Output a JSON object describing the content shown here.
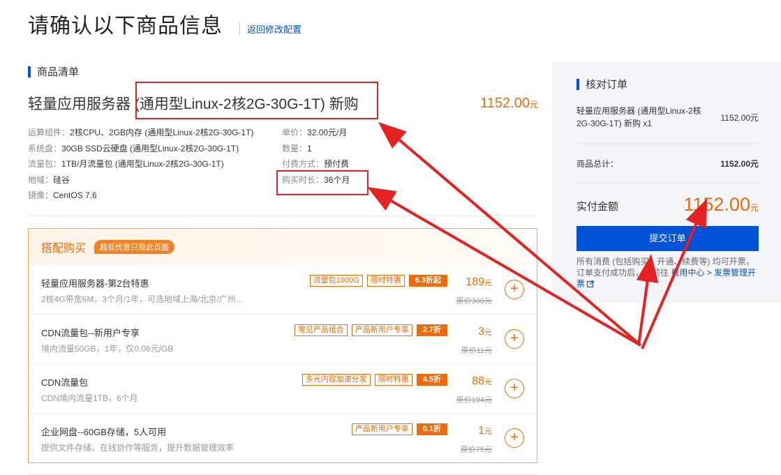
{
  "header": {
    "title": "请确认以下商品信息",
    "back_link": "返回修改配置"
  },
  "product_list": {
    "heading": "商品清单",
    "title": "轻量应用服务器 (通用型Linux-2核2G-30G-1T) 新购",
    "price": "1152.00",
    "price_unit": "元",
    "specs_left": [
      {
        "k": "运算组件：",
        "v": "2核CPU、2GB内存 (通用型Linux-2核2G-30G-1T)"
      },
      {
        "k": "系统盘：",
        "v": "30GB SSD云硬盘 (通用型Linux-2核2G-30G-1T)"
      },
      {
        "k": "流量包：",
        "v": "1TB/月流量包 (通用型Linux-2核2G-30G-1T)"
      },
      {
        "k": "地域：",
        "v": "硅谷"
      },
      {
        "k": "镜像：",
        "v": "CentOS 7.6"
      }
    ],
    "specs_right": [
      {
        "k": "单价：",
        "v": "32.00元/月"
      },
      {
        "k": "数量：",
        "v": "1"
      },
      {
        "k": "付费方式：",
        "v": "预付费"
      },
      {
        "k": "购买时长：",
        "v": "36个月"
      }
    ]
  },
  "combo": {
    "title": "搭配购买",
    "tag": "超低优惠只限此页面",
    "items": [
      {
        "name": "轻量应用服务器-第2台特惠",
        "desc": "2核4G带宽6M，3个月/1年，可选地域上海/北京/广州...",
        "tags": [
          "流量包1000G",
          "限时特惠"
        ],
        "discount": "6.3折起",
        "price": "189",
        "unit": "元",
        "orig": "原价300元"
      },
      {
        "name": "CDN流量包--新用户专享",
        "desc": "境内流量50GB，1年，仅0.06元/GB",
        "tags": [
          "常见产品组合",
          "产品新用户专享"
        ],
        "discount": "2.7折",
        "price": "3",
        "unit": "元",
        "orig": "原价11元"
      },
      {
        "name": "CDN流量包",
        "desc": "CDN境内流量1TB，6个月",
        "tags": [
          "多元内容加速分发",
          "限时特惠"
        ],
        "discount": "4.5折",
        "price": "88",
        "unit": "元",
        "orig": "原价194元"
      },
      {
        "name": "企业网盘--60GB存储，5人可用",
        "desc": "提供文件存储、在线协作等服务，提升数据管理效率",
        "tags": [
          "产品新用户专享"
        ],
        "discount": "0.1折",
        "price": "1",
        "unit": "元",
        "orig": "原价75元"
      }
    ],
    "add_symbol": "+"
  },
  "sidebar": {
    "heading": "核对订单",
    "item_name": "轻量应用服务器 (通用型Linux-2核2G-30G-1T) 新购 x1",
    "item_price": "1152.00元",
    "total_label": "商品总计：",
    "total_value": "1152.00元",
    "pay_label": "实付金额",
    "pay_value": "1152.00",
    "pay_unit": "元",
    "submit": "提交订单",
    "note_prefix": "所有消费 (包括购买、开通、续费等) 均可开票，订单支付成功后，可前往 ",
    "note_link1": "费用中心",
    "note_sep": " > ",
    "note_link2": "发票管理开票",
    "note_icon": "external-link-icon"
  },
  "colors": {
    "accent": "#0052d9",
    "price": "#f06a0a",
    "annotation": "#e62121"
  }
}
